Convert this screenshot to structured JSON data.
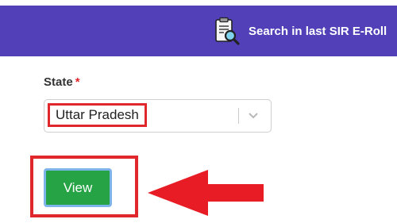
{
  "header": {
    "search_label": "Search in last SIR E-Roll",
    "search_icon": "clipboard-search-icon",
    "background_color": "#5240b8"
  },
  "form": {
    "state_label": "State",
    "required_marker": "*",
    "state_value": "Uttar Pradesh",
    "view_label": "View"
  },
  "colors": {
    "highlight": "#e0272b",
    "view_button": "#26a344"
  }
}
